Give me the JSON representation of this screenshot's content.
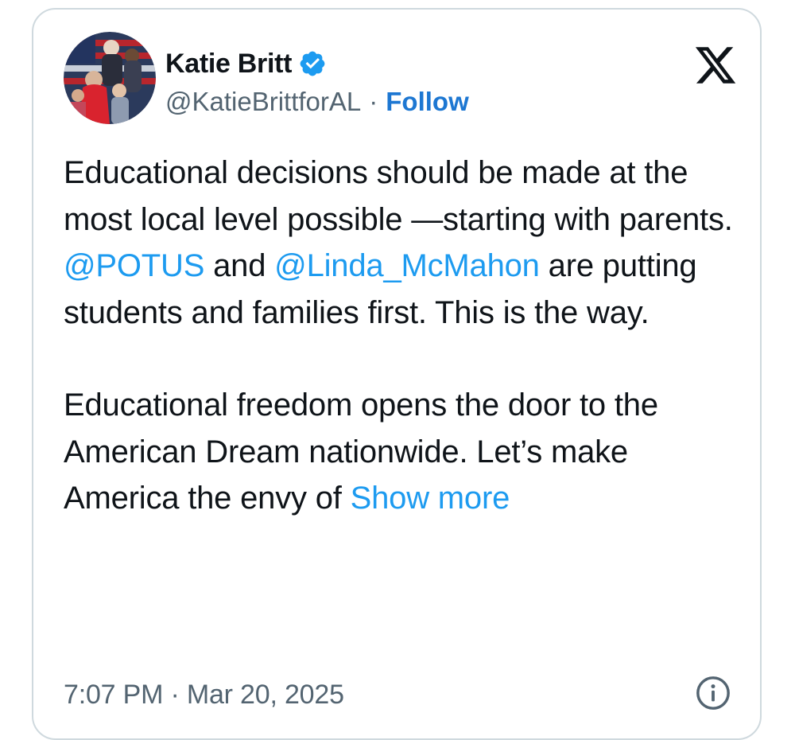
{
  "author": {
    "name": "Katie Britt",
    "handle": "@KatieBrittforAL",
    "separator": "·",
    "follow_label": "Follow",
    "verified_color": "#1d9bf0"
  },
  "icons": {
    "verified": "verified-badge-icon",
    "brand": "x-logo-icon",
    "info": "info-icon"
  },
  "tweet": {
    "p1_text_1": "Educational decisions should be made at the most local level possible —starting with parents. ",
    "mention_1": "@POTUS",
    "p1_text_2": " and ",
    "mention_2": "@Linda_McMahon",
    "p1_text_3": " are putting students and families first. This is the way.",
    "p2_text": "Educational freedom opens the door to the American Dream nationwide. Let’s make America the envy of ",
    "show_more": "Show more"
  },
  "footer": {
    "timestamp": "7:07 PM · Mar 20, 2025"
  },
  "colors": {
    "link": "#1d9bf0",
    "follow": "#1d77d2",
    "text": "#0f1419",
    "muted": "#536471",
    "border": "#cfd9de"
  }
}
